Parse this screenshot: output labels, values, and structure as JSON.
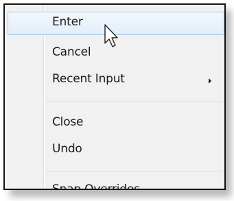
{
  "menu": {
    "items": [
      {
        "label": "Enter",
        "has_submenu": false,
        "highlighted": true
      },
      {
        "label": "Cancel",
        "has_submenu": false,
        "highlighted": false
      },
      {
        "label": "Recent Input",
        "has_submenu": true,
        "highlighted": false
      },
      {
        "label": "Close",
        "has_submenu": false,
        "highlighted": false
      },
      {
        "label": "Undo",
        "has_submenu": false,
        "highlighted": false
      },
      {
        "label": "Snap Overrides",
        "has_submenu": true,
        "highlighted": false
      }
    ]
  },
  "colors": {
    "highlight_border": "#a8c8e8",
    "menu_background": "#f1f1f1",
    "frame_border": "#111111"
  },
  "icons": {
    "submenu": "chevron-right-icon",
    "pointer": "mouse-cursor-icon"
  }
}
